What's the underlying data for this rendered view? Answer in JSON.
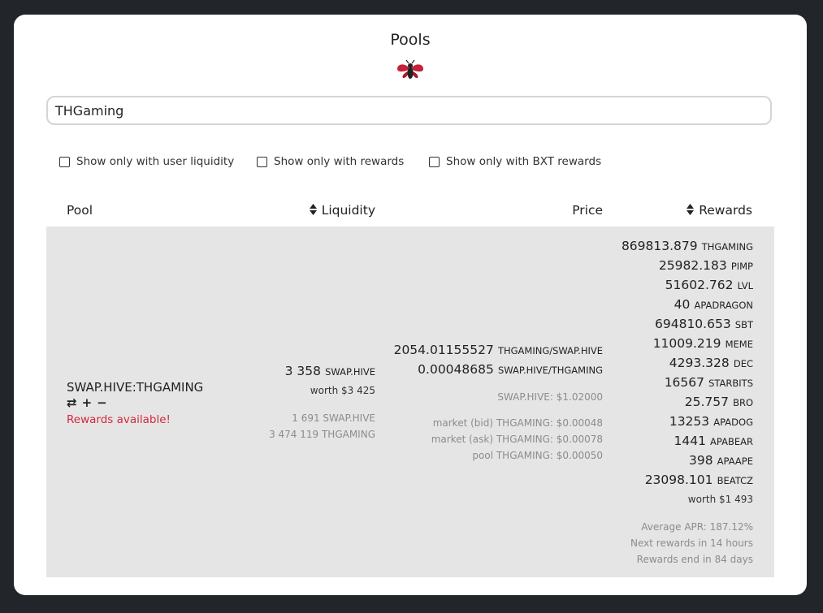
{
  "page": {
    "title": "Pools"
  },
  "search": {
    "value": "THGaming"
  },
  "filters": [
    {
      "label": "Show only with user liquidity"
    },
    {
      "label": "Show only with rewards"
    },
    {
      "label": "Show only with BXT rewards"
    }
  ],
  "table": {
    "headers": {
      "pool": "Pool",
      "liquidity": "Liquidity",
      "price": "Price",
      "rewards": "Rewards"
    }
  },
  "row": {
    "pool": "SWAP.HIVE:THGAMING",
    "actions": {
      "swap": "⇄",
      "add": "+",
      "remove": "−"
    },
    "rewards_available": "Rewards available!",
    "liquidity": {
      "amount": "3 358",
      "token": "SWAP.HIVE",
      "worth": "worth $3 425",
      "base": "1 691 SWAP.HIVE",
      "quote": "3 474 119 THGAMING"
    },
    "price": {
      "p1": "2054.01155527",
      "p1_pair": "THGAMING/SWAP.HIVE",
      "p2": "0.00048685",
      "p2_pair": "SWAP.HIVE/THGAMING",
      "swap_hive": "SWAP.HIVE: $1.02000",
      "bid": "market (bid) THGAMING: $0.00048",
      "ask": "market (ask) THGAMING: $0.00078",
      "pool": "pool THGAMING: $0.00050"
    },
    "rewards": {
      "items": [
        {
          "amount": "869813.879",
          "token": "THGAMING"
        },
        {
          "amount": "25982.183",
          "token": "PIMP"
        },
        {
          "amount": "51602.762",
          "token": "LVL"
        },
        {
          "amount": "40",
          "token": "APADRAGON"
        },
        {
          "amount": "694810.653",
          "token": "SBT"
        },
        {
          "amount": "11009.219",
          "token": "MEME"
        },
        {
          "amount": "4293.328",
          "token": "DEC"
        },
        {
          "amount": "16567",
          "token": "STARBITS"
        },
        {
          "amount": "25.757",
          "token": "BRO"
        },
        {
          "amount": "13253",
          "token": "APADOG"
        },
        {
          "amount": "1441",
          "token": "APABEAR"
        },
        {
          "amount": "398",
          "token": "APAAPE"
        },
        {
          "amount": "23098.101",
          "token": "BEATCZ"
        }
      ],
      "worth": "worth $1 493",
      "apr": "Average APR: 187.12%",
      "next": "Next rewards in 14 hours",
      "end": "Rewards end in 84 days"
    }
  },
  "colors": {
    "accent": "#d4293d",
    "background": "#22262b",
    "row": "#e5e5e5"
  }
}
